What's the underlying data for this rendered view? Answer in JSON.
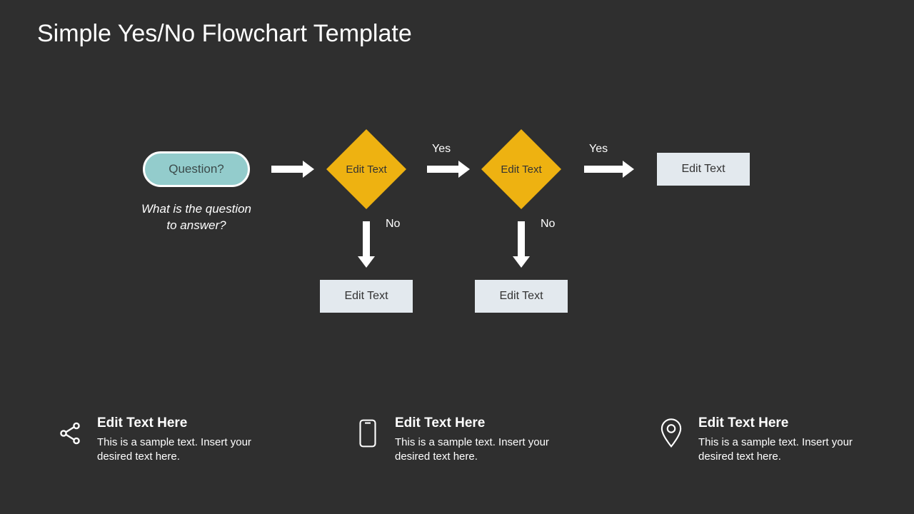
{
  "title": "Simple Yes/No Flowchart Template",
  "flow": {
    "start": "Question?",
    "caption": "What is the question\nto answer?",
    "decision1": "Edit Text",
    "decision2": "Edit Text",
    "resultYes": "Edit Text",
    "resultNo1": "Edit Text",
    "resultNo2": "Edit Text",
    "yes1": "Yes",
    "yes2": "Yes",
    "no1": "No",
    "no2": "No"
  },
  "footer": [
    {
      "title": "Edit Text Here",
      "body": "This is a sample text. Insert your desired text here."
    },
    {
      "title": "Edit Text Here",
      "body": "This is a sample text. Insert your desired text here."
    },
    {
      "title": "Edit Text Here",
      "body": "This is a sample text. Insert your desired text here."
    }
  ]
}
